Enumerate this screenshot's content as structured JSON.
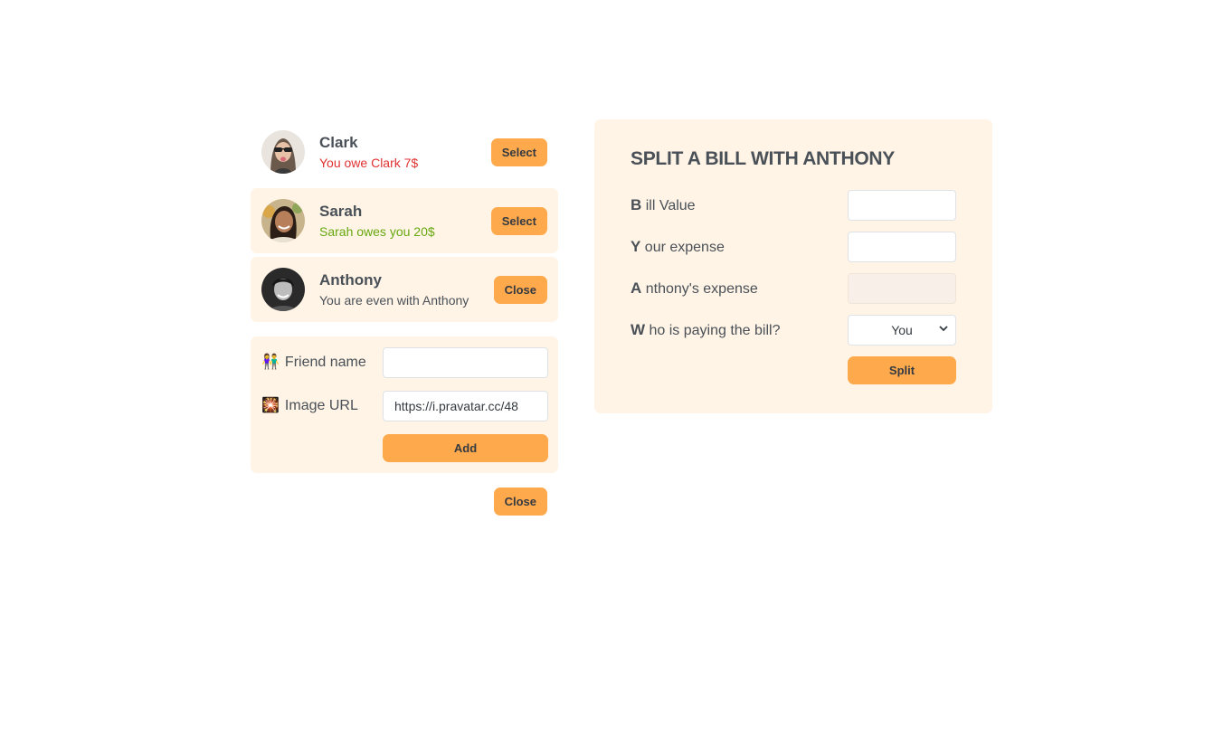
{
  "friends": [
    {
      "name": "Clark",
      "status": "You owe Clark 7$",
      "tone": "red",
      "button": "Select",
      "active": false
    },
    {
      "name": "Sarah",
      "status": "Sarah owes you 20$",
      "tone": "green",
      "button": "Select",
      "active": true
    },
    {
      "name": "Anthony",
      "status": "You are even with Anthony",
      "tone": "neutral",
      "button": "Close",
      "active": true
    }
  ],
  "add_form": {
    "name_emoji": "👫",
    "name_label": "Friend name",
    "name_value": "",
    "image_emoji": "🎇",
    "image_label": "Image URL",
    "image_value": "https://i.pravatar.cc/48",
    "add_label": "Add"
  },
  "close_label": "Close",
  "split": {
    "title": "SPLIT A BILL WITH ANTHONY",
    "bill_cap": "B",
    "bill_rest": " ill Value",
    "your_cap": "Y",
    "your_rest": " our expense",
    "friend_cap": "A",
    "friend_rest": " nthony's expense",
    "who_cap": "W",
    "who_rest": " ho is paying the bill?",
    "payer_selected": "You",
    "split_label": "Split"
  },
  "colors": {
    "accent": "#ffa94d",
    "panel": "#fff4e6",
    "owe": "#e03131",
    "owed": "#66a80f"
  },
  "icons": [
    "avatar-clark",
    "avatar-sarah",
    "avatar-anthony",
    "people-emoji-icon",
    "sparkle-emoji-icon",
    "chevron-down-icon"
  ]
}
